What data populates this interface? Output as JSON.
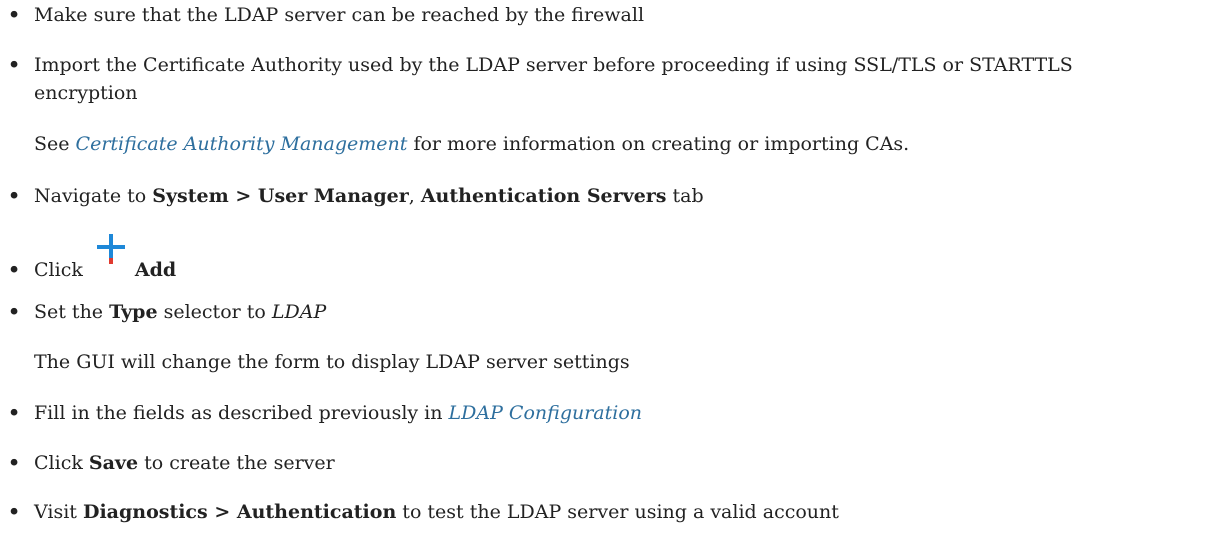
{
  "items": [
    {
      "text": "Make sure that the LDAP server can be reached by the firewall"
    },
    {
      "text_line1": "Import the Certificate Authority used by the LDAP server before proceeding if using SSL/TLS or STARTTLS",
      "text_line2": "encryption"
    },
    {
      "pre": "See ",
      "link": "Certificate Authority Management",
      "post": " for more information on creating or importing CAs."
    },
    {
      "pre": "Navigate to ",
      "bold1": "System > User Manager",
      "mid": ", ",
      "bold2": "Authentication Servers",
      "post": " tab"
    },
    {
      "pre": "Click",
      "bold": "Add",
      "icon": "plus-icon"
    },
    {
      "pre": "Set the ",
      "bold": "Type",
      "mid": " selector to ",
      "italic": "LDAP"
    },
    {
      "text": "The GUI will change the form to display LDAP server settings"
    },
    {
      "pre": "Fill in the fields as described previously in ",
      "link": "LDAP Configuration"
    },
    {
      "pre": "Click ",
      "bold": "Save",
      "post": " to create the server"
    },
    {
      "pre": "Visit ",
      "bold": "Diagnostics > Authentication",
      "post": " to test the LDAP server using a valid account"
    }
  ],
  "bullet": "•",
  "colors": {
    "link": "#2e6f9e",
    "text": "#222222",
    "icon_blue": "#1e88d8",
    "icon_red": "#e03a2f"
  }
}
